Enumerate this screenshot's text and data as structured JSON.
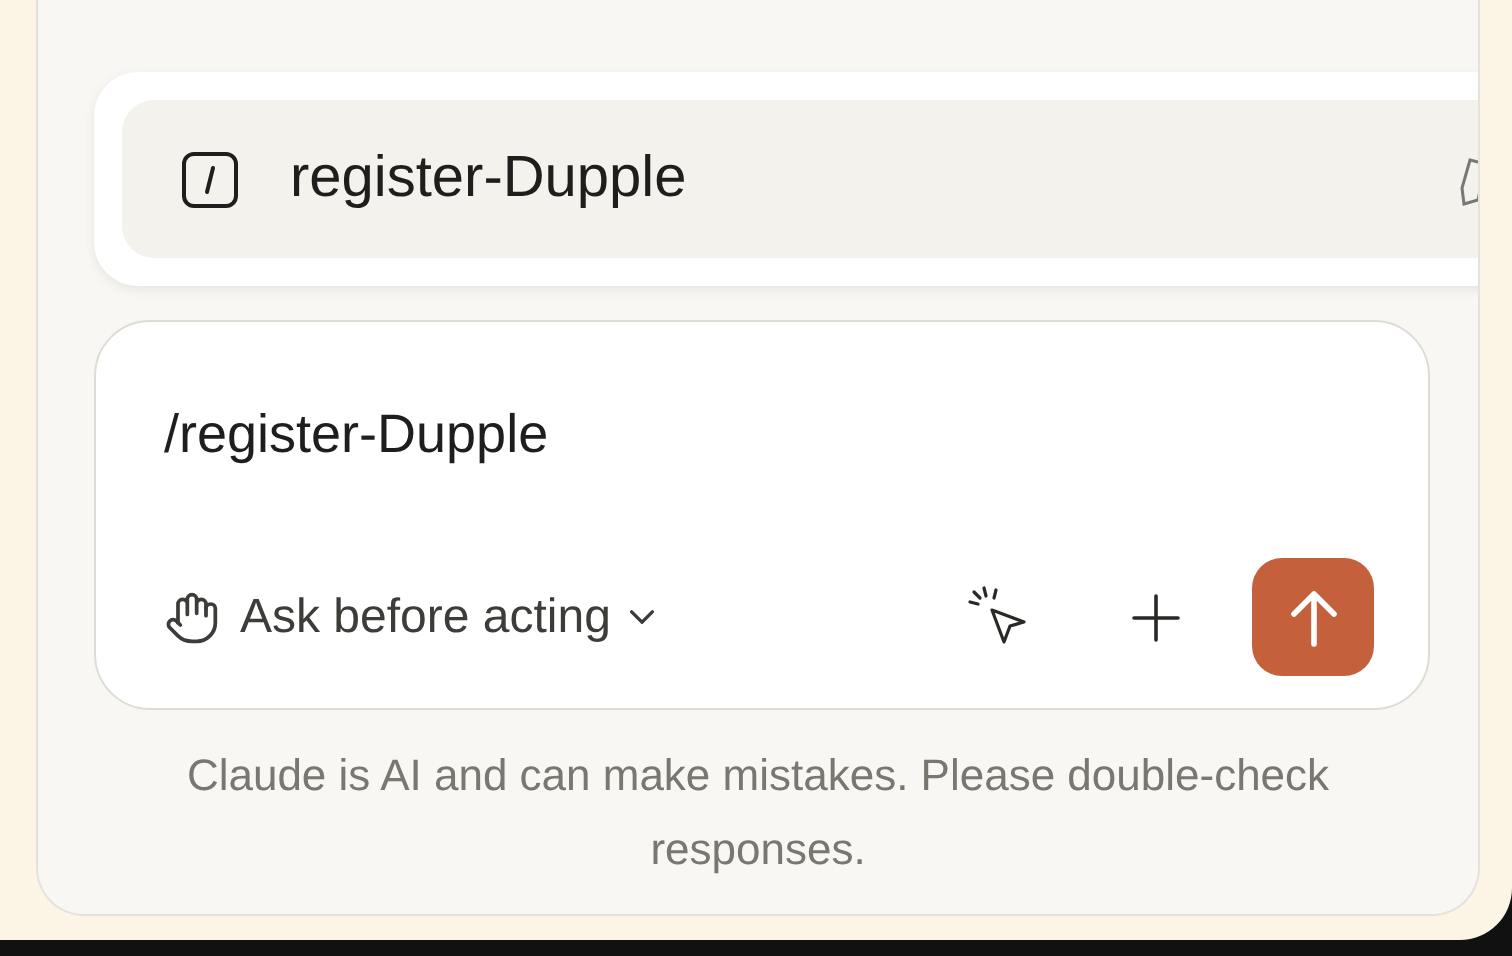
{
  "suggestion": {
    "label": "register-Dupple"
  },
  "composer": {
    "value": "/register-Dupple",
    "mode": "Ask before acting"
  },
  "disclaimer": "Claude is AI and can make mistakes. Please double-check responses."
}
